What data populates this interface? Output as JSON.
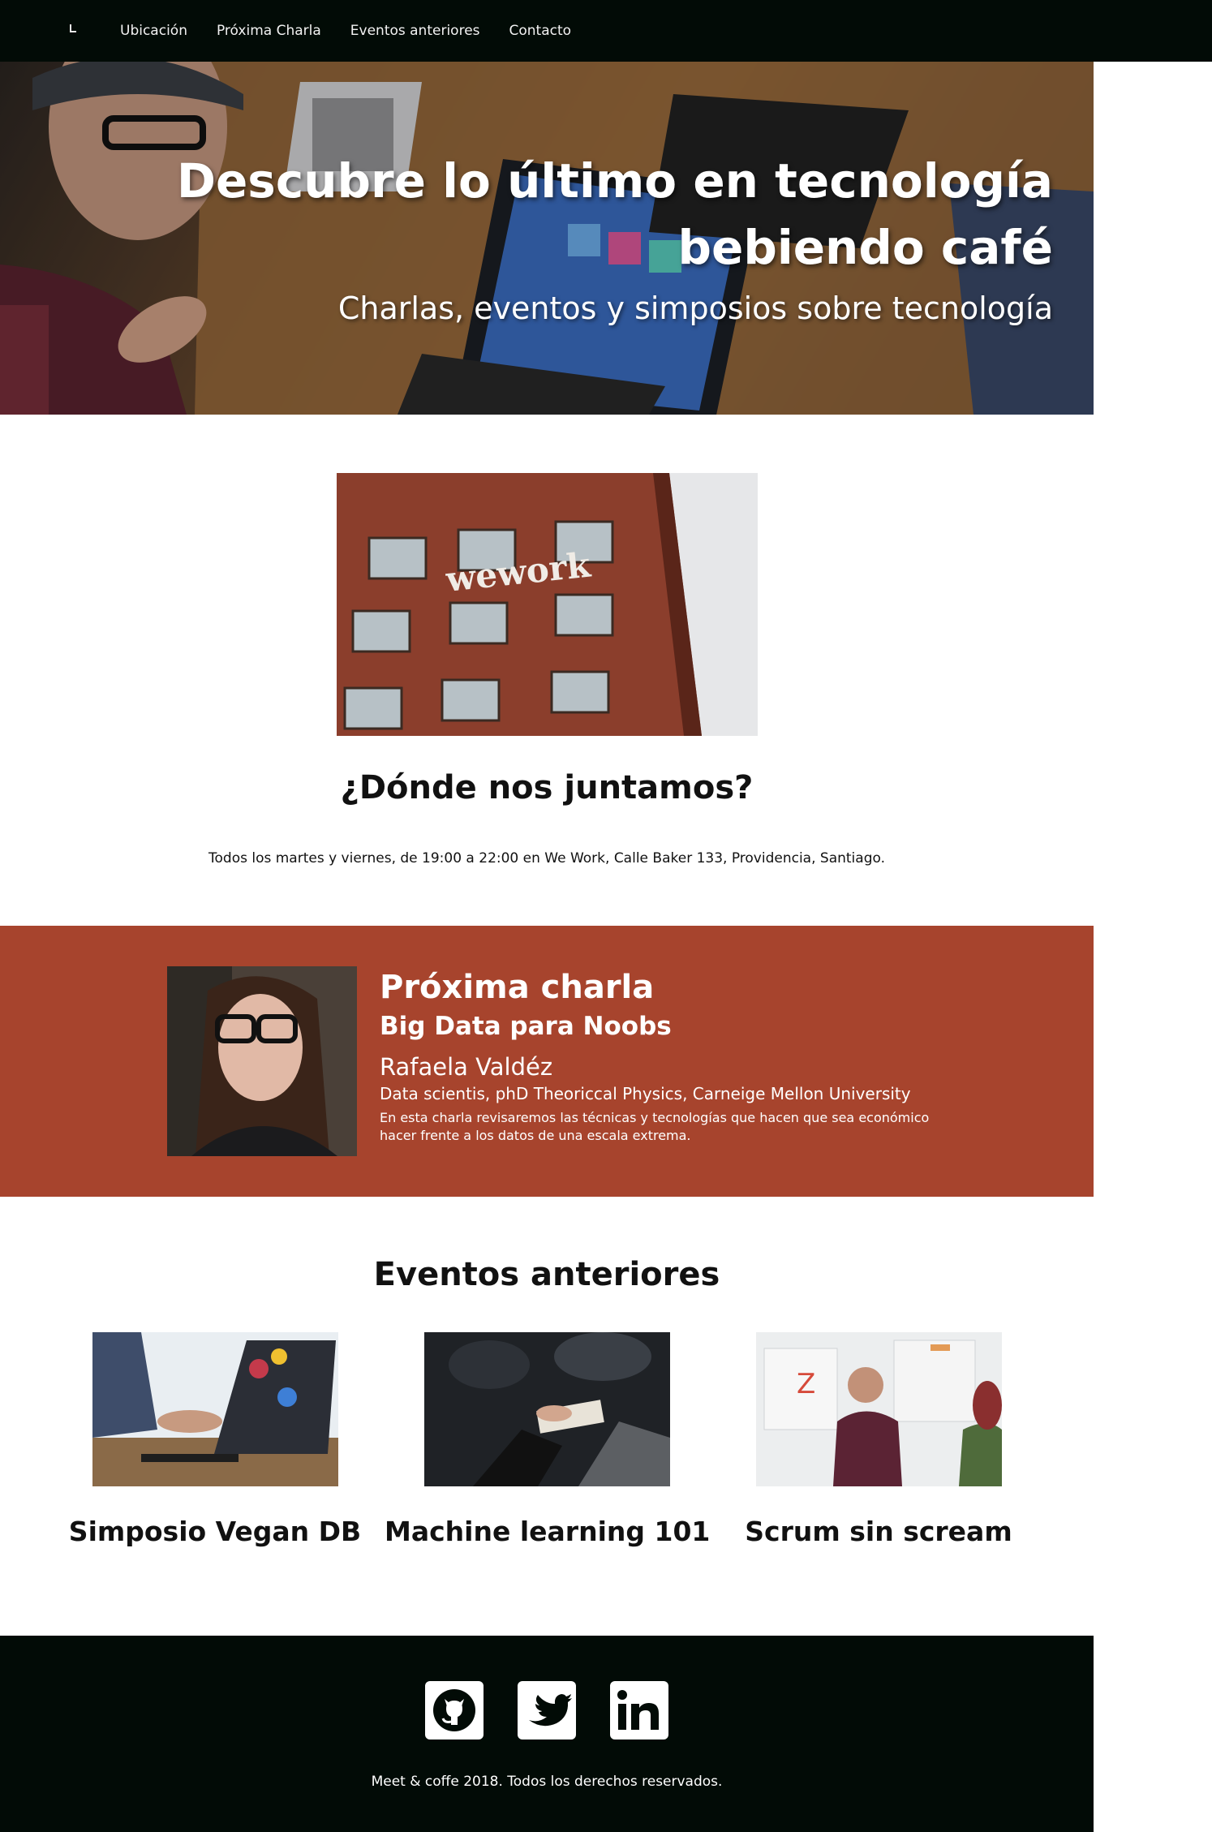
{
  "nav": {
    "items": [
      "Ubicación",
      "Próxima Charla",
      "Eventos anteriores",
      "Contacto"
    ]
  },
  "hero": {
    "title": "Descubre lo último en tecnología bebiendo café",
    "subtitle": "Charlas, eventos y simposios sobre tecnología",
    "sign_text": "wework"
  },
  "location": {
    "image_sign": "wework",
    "title": "¿Dónde nos juntamos?",
    "text": "Todos los martes y viernes, de 19:00 a 22:00 en We Work, Calle Baker 133, Providencia, Santiago."
  },
  "next_talk": {
    "heading": "Próxima charla",
    "title": "Big Data para Noobs",
    "speaker": "Rafaela Valdéz",
    "role": "Data scientis, phD Theoriccal Physics, Carneige Mellon University",
    "description": "En esta charla revisaremos las técnicas y tecnologías que hacen que sea económico hacer frente a los datos de una escala extrema."
  },
  "past_events": {
    "title": "Eventos anteriores",
    "items": [
      {
        "title": "Simposio Vegan DB"
      },
      {
        "title": "Machine learning 101"
      },
      {
        "title": "Scrum sin scream"
      }
    ]
  },
  "footer": {
    "social": [
      "github-icon",
      "twitter-icon",
      "linkedin-icon"
    ],
    "copyright": "Meet & coffe 2018. Todos los derechos reservados."
  },
  "colors": {
    "nav_bg": "#020b06",
    "talk_bg": "#a7442d",
    "footer_bg": "#020b06"
  }
}
